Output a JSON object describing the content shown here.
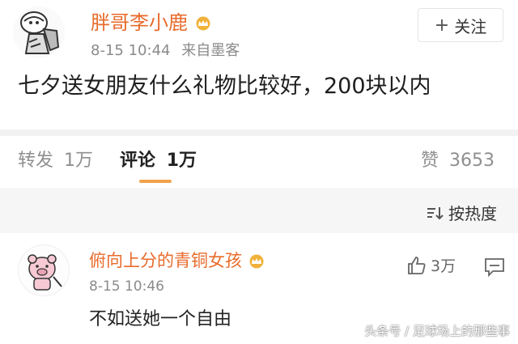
{
  "post": {
    "username": "胖哥李小鹿",
    "date": "8-15",
    "time": "10:44",
    "source": "来自墨客",
    "follow_label": "关注",
    "text": "七夕送女朋友什么礼物比较好，200块以内"
  },
  "actions": {
    "repost_label": "转发",
    "repost_count": "1万",
    "comment_label": "评论",
    "comment_count": "1万",
    "like_label": "赞",
    "like_count": "3653"
  },
  "sort": {
    "label": "按热度"
  },
  "comment": {
    "username": "俯向上分的青铜女孩",
    "time": "8-15 10:46",
    "text": "不如送她一个自由",
    "like_count": "3万"
  },
  "watermark": "头条号 / 足球场上的那些事",
  "colors": {
    "username": "#e86b2c",
    "tab_underline": "#f3a24a",
    "vip_crown": "#f0b23a"
  }
}
